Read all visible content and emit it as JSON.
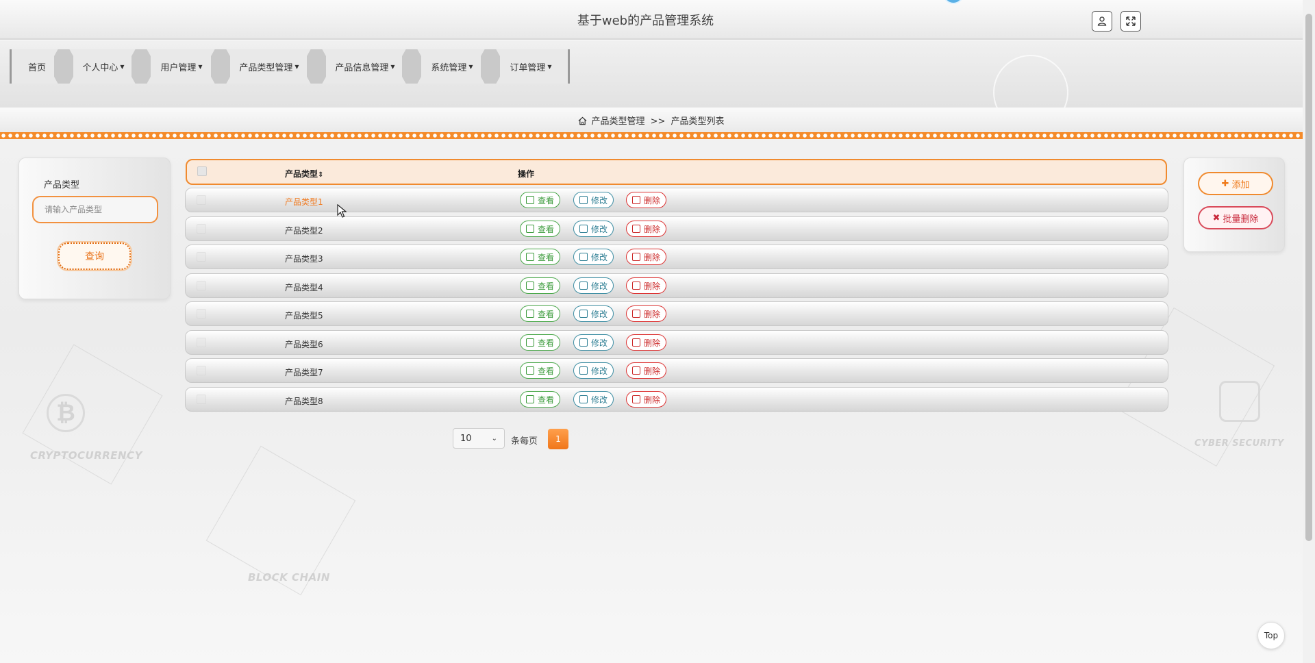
{
  "header": {
    "title": "基于web的产品管理系统"
  },
  "nav": {
    "items": [
      {
        "label": "首页",
        "dropdown": false
      },
      {
        "label": "个人中心",
        "dropdown": true
      },
      {
        "label": "用户管理",
        "dropdown": true
      },
      {
        "label": "产品类型管理",
        "dropdown": true
      },
      {
        "label": "产品信息管理",
        "dropdown": true
      },
      {
        "label": "系统管理",
        "dropdown": true
      },
      {
        "label": "订单管理",
        "dropdown": true
      }
    ]
  },
  "breadcrumb": {
    "parent": "产品类型管理",
    "separator": ">>",
    "current": "产品类型列表"
  },
  "search": {
    "label": "产品类型",
    "placeholder": "请输入产品类型",
    "button": "查询"
  },
  "table": {
    "headers": {
      "type": "产品类型",
      "sort_icon": "⇕",
      "ops": "操作"
    },
    "actions": {
      "view": "查看",
      "edit": "修改",
      "delete": "删除"
    },
    "rows": [
      "产品类型1",
      "产品类型2",
      "产品类型3",
      "产品类型4",
      "产品类型5",
      "产品类型6",
      "产品类型7",
      "产品类型8"
    ]
  },
  "pagination": {
    "page_size": "10",
    "per_page_label": "条每页",
    "current_page": "1"
  },
  "actions": {
    "add": "添加",
    "bulk_delete": "批量删除"
  },
  "background_text": [
    "CRYPTOCURRENCY",
    "BLOCK CHAIN",
    "CYBER SECURITY"
  ],
  "top_button": "Top",
  "colors": {
    "accent": "#f08a2e",
    "view": "#3a9a3a",
    "edit": "#2f7f94",
    "delete": "#cc2b2b"
  }
}
